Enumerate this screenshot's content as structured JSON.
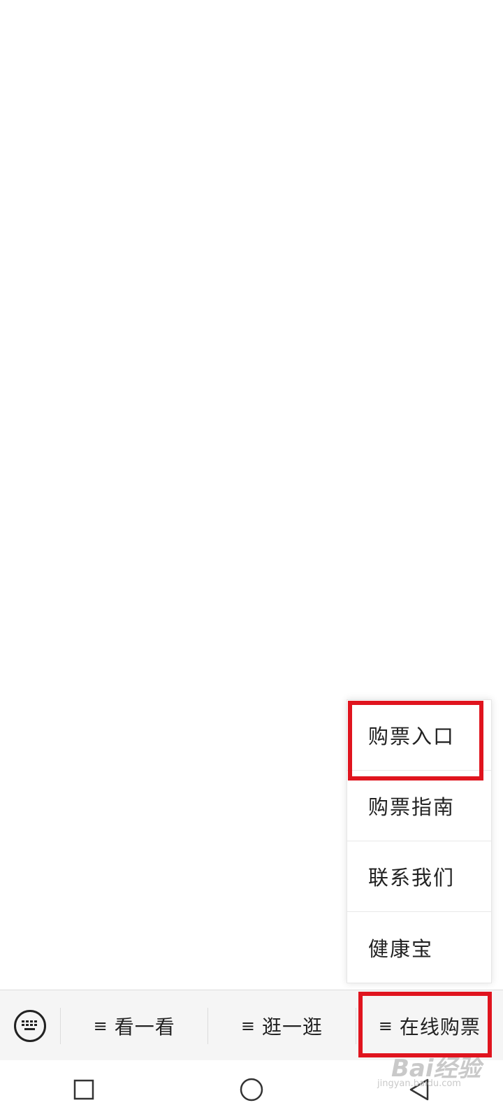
{
  "submenu": {
    "items": [
      {
        "label": "购票入口"
      },
      {
        "label": "购票指南"
      },
      {
        "label": "联系我们"
      },
      {
        "label": "健康宝"
      }
    ]
  },
  "menu_bar": {
    "keyboard_icon": "keyboard-icon",
    "tabs": [
      {
        "icon": "≡",
        "label": "看一看"
      },
      {
        "icon": "≡",
        "label": "逛一逛"
      },
      {
        "icon": "≡",
        "label": "在线购票"
      }
    ]
  },
  "nav_bar": {
    "buttons": [
      "recent-apps-icon",
      "home-icon",
      "back-icon"
    ]
  },
  "watermark": {
    "main": "Bai经验",
    "sub": "jingyan.baidu.com"
  },
  "colors": {
    "highlight": "#e0141e",
    "menu_bar_bg": "#f5f5f5"
  }
}
